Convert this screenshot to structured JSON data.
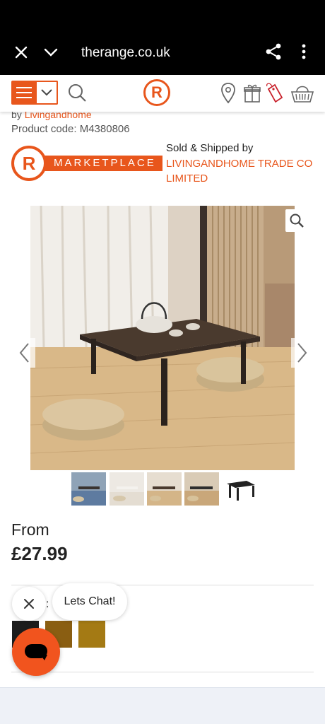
{
  "browser": {
    "url": "therange.co.uk"
  },
  "product": {
    "by_prefix": "by",
    "brand": "Livingandhome",
    "code": "Product code: M4380806",
    "marketplace_logo_letter": "R",
    "marketplace_label": "MARKETPLACE",
    "sold_by_title": "Sold & Shipped by",
    "seller": "LIVINGANDHOME TRADE CO LIMITED",
    "price_prefix": "From",
    "price": "£27.99"
  },
  "header": {
    "logo_letter": "R"
  },
  "gallery": {
    "thumbnail_count": 5
  },
  "options": {
    "colour_label": ":",
    "swatches": [
      "#1c1c1c",
      "#8a5e12",
      "#a47a14"
    ]
  },
  "chat": {
    "label": "Lets Chat!"
  },
  "colors": {
    "brand": "#e8561c",
    "chat": "#f1541e"
  }
}
